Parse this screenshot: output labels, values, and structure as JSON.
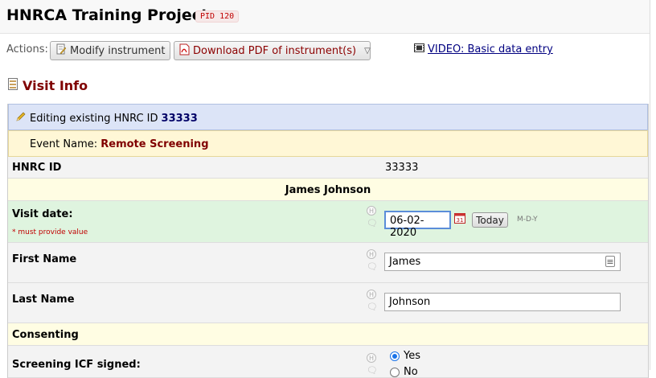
{
  "header": {
    "project_title": "HNRCA Training Project",
    "pid_badge": "PID 120"
  },
  "actions": {
    "label": "Actions:",
    "modify_button": "Modify instrument",
    "pdf_button": "Download PDF of instrument(s)",
    "video_link": "VIDEO: Basic data entry"
  },
  "section": {
    "title": "Visit Info"
  },
  "record": {
    "editing_prefix": "Editing existing HNRC ID",
    "record_id": "33333",
    "event_prefix": "Event Name:",
    "event_name": "Remote Screening"
  },
  "fields": {
    "hnrc_id": {
      "label": "HNRC ID",
      "value": "33333"
    },
    "name_header": "James Johnson",
    "visit_date": {
      "label": "Visit date:",
      "required_note": "* must provide value",
      "value": "06-02-2020",
      "today_button": "Today",
      "format": "M-D-Y"
    },
    "first_name": {
      "label": "First Name",
      "value": "James"
    },
    "last_name": {
      "label": "Last Name",
      "value": "Johnson"
    },
    "consent_header": "Consenting",
    "screening_icf": {
      "label": "Screening ICF signed:",
      "options": [
        "Yes",
        "No"
      ],
      "selected": "Yes"
    }
  },
  "icons": {
    "field_help": "H",
    "comment": "comment-bubble-icon",
    "calendar": "calendar-icon",
    "video": "film-icon",
    "pencil": "pencil-icon",
    "form": "form-icon",
    "pdf": "pdf-icon"
  },
  "colors": {
    "section_title": "#800000",
    "editing_bg": "#dce4f7",
    "event_bg": "#fff7d6",
    "visit_date_row_bg": "#dff4df",
    "header_row_bg": "#fffde3",
    "pid_text": "#c00000",
    "radio_selected": "#1a73e8"
  }
}
